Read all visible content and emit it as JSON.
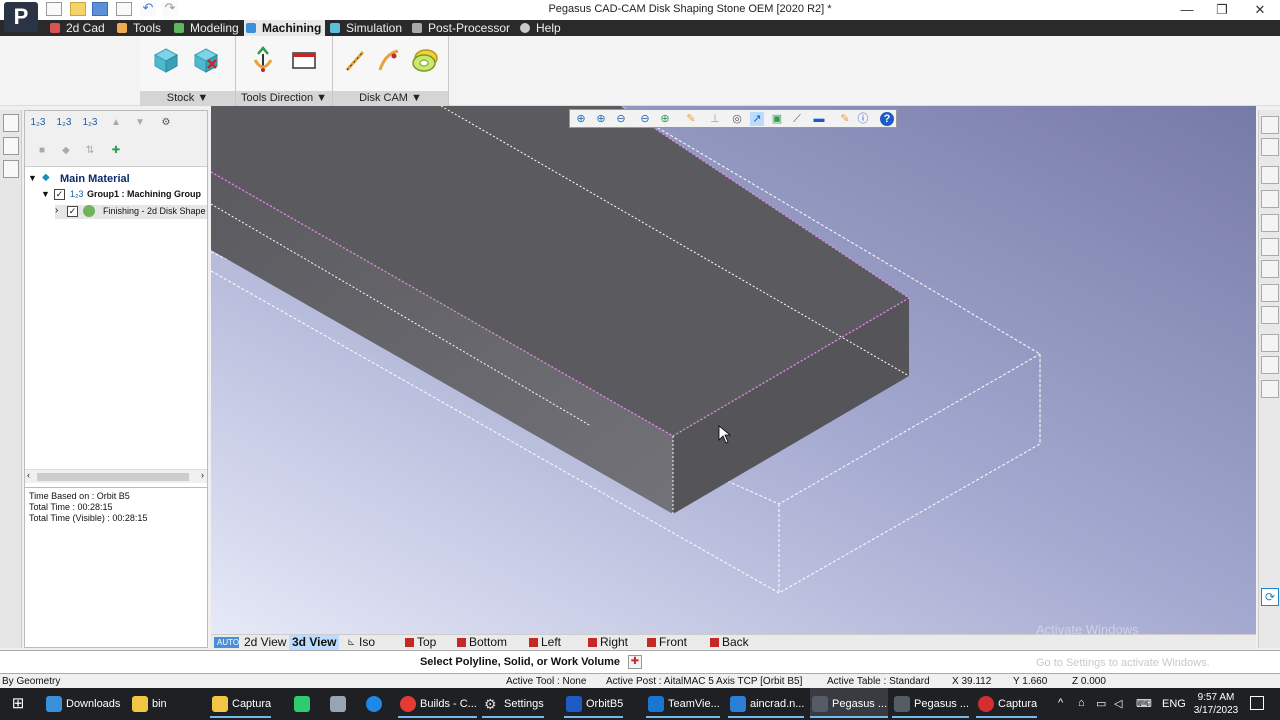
{
  "window": {
    "title": "Pegasus CAD-CAM Disk Shaping Stone OEM [2020 R2] *",
    "logo_text": "P",
    "minimize": "—",
    "maximize": "❐",
    "close": "✕"
  },
  "menu": {
    "items": [
      {
        "label": "2d Cad",
        "icon": "cad-icon",
        "color": "#d9534f"
      },
      {
        "label": "Tools",
        "icon": "tools-icon",
        "color": "#f0ad4e"
      },
      {
        "label": "Modeling",
        "icon": "modeling-icon",
        "color": "#5cb85c"
      },
      {
        "label": "Machining",
        "icon": "machining-icon",
        "color": "#3a8fd9"
      },
      {
        "label": "Simulation",
        "icon": "simulation-icon",
        "color": "#5bc0de"
      },
      {
        "label": "Post-Processor",
        "icon": "post-processor-icon",
        "color": "#aaaaaa"
      },
      {
        "label": "Help",
        "icon": "help-icon",
        "color": "#cccccc"
      }
    ],
    "active": "Machining"
  },
  "ribbon": {
    "groups": [
      {
        "label": "Stock",
        "dropdown": "▼"
      },
      {
        "label": "Tools Direction",
        "dropdown": "▼"
      },
      {
        "label": "Disk CAM",
        "dropdown": "▼"
      }
    ]
  },
  "tree": {
    "root": "Main Material",
    "group": "Group1 : Machining Group",
    "operation": "Finishing - 2d Disk Shape",
    "expand_open": "▼",
    "expand_closed": "›",
    "check": "✓"
  },
  "info": {
    "lines": [
      "Time Based on : Orbit B5",
      "Total Time : 00:28:15",
      "Total Time (Visible) : 00:28:15"
    ]
  },
  "view_tabs": {
    "auto_label": "AUTO",
    "items": [
      {
        "label": "2d View"
      },
      {
        "label": "3d View"
      },
      {
        "label": "Iso"
      },
      {
        "label": "Top"
      },
      {
        "label": "Bottom"
      },
      {
        "label": "Left"
      },
      {
        "label": "Right"
      },
      {
        "label": "Front"
      },
      {
        "label": "Back"
      }
    ],
    "active": "3d View"
  },
  "prompt": {
    "text": "Select Polyline, Solid, or Work Volume"
  },
  "watermark": {
    "line1": "Activate Windows",
    "line2": "Go to Settings to activate Windows."
  },
  "status": {
    "left": "By Geometry",
    "active_tool": "Active Tool : None",
    "active_post": "Active Post : AitalMAC 5 Axis TCP [Orbit B5]",
    "active_table": "Active Table : Standard",
    "x": "X 39.112",
    "y": "Y 1.660",
    "z": "Z 0.000"
  },
  "taskbar": {
    "items": [
      {
        "label": "Downloads",
        "color": "#3a8fd9"
      },
      {
        "label": "bin",
        "color": "#f2c744"
      },
      {
        "label": "Captura",
        "color": "#f2c744"
      },
      {
        "label": "",
        "color": "#2ecc71"
      },
      {
        "label": "",
        "color": "#9aa4b0"
      },
      {
        "label": "",
        "color": "#1e88e5"
      },
      {
        "label": "Builds - C...",
        "color": "#e53935"
      },
      {
        "label": "Settings",
        "color": "#cccccc"
      },
      {
        "label": "OrbitB5",
        "color": "#1e5bc6"
      },
      {
        "label": "TeamVie...",
        "color": "#1976d2"
      },
      {
        "label": "aincrad.n...",
        "color": "#2a7fd4"
      },
      {
        "label": "Pegasus ...",
        "color": "#555c66"
      },
      {
        "label": "Pegasus ...",
        "color": "#555c66"
      },
      {
        "label": "Captura",
        "color": "#d32f2f"
      }
    ],
    "language": "ENG",
    "time": "9:57 AM",
    "date": "3/17/2023"
  }
}
